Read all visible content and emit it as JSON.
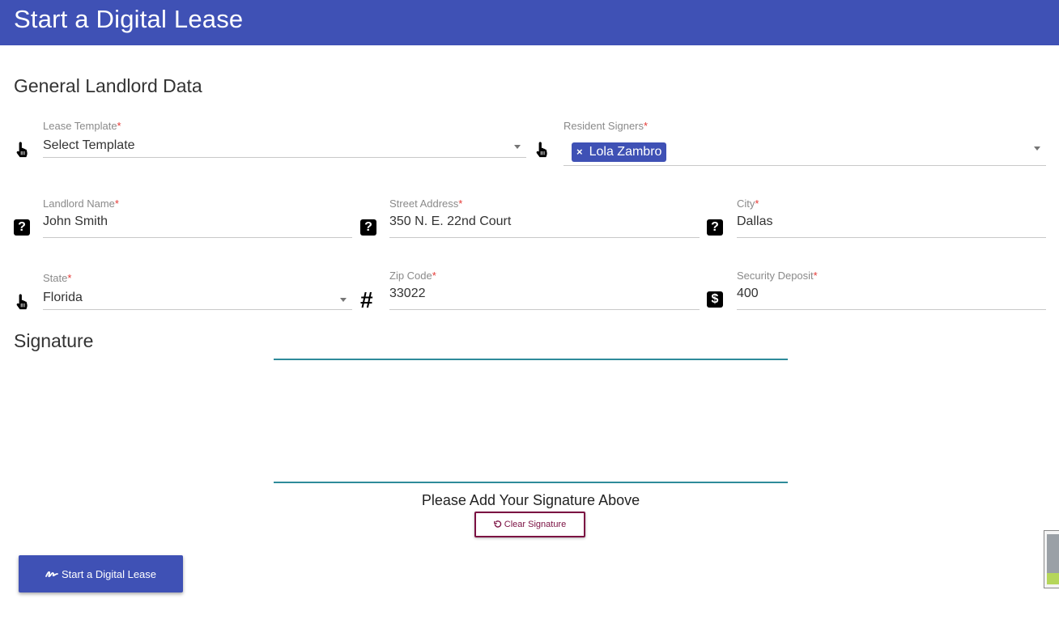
{
  "header": {
    "title": "Start a Digital Lease"
  },
  "sections": {
    "general": "General Landlord Data",
    "signature": "Signature"
  },
  "fields": {
    "lease_template": {
      "label": "Lease Template",
      "required": "*",
      "value": "Select Template",
      "icon": "pointer-hand-icon"
    },
    "resident_signers": {
      "label": "Resident Signers",
      "required": "*",
      "chip": "Lola Zambro",
      "chip_remove": "×",
      "icon": "pointer-hand-icon"
    },
    "landlord_name": {
      "label": "Landlord Name",
      "required": "*",
      "value": "John Smith",
      "icon": "question-icon"
    },
    "street_address": {
      "label": "Street Address",
      "required": "*",
      "value": "350 N. E. 22nd Court",
      "icon": "question-icon"
    },
    "city": {
      "label": "City",
      "required": "*",
      "value": "Dallas",
      "icon": "question-icon"
    },
    "state": {
      "label": "State",
      "required": "*",
      "value": "Florida",
      "icon": "pointer-hand-icon"
    },
    "zip_code": {
      "label": "Zip Code",
      "required": "*",
      "value": "33022",
      "icon": "hash-icon",
      "icon_glyph": "#"
    },
    "security_deposit": {
      "label": "Security Deposit",
      "required": "*",
      "value": "400",
      "icon": "dollar-icon",
      "icon_glyph": "$"
    }
  },
  "question_glyph": "?",
  "signature": {
    "hint": "Please Add Your Signature Above",
    "clear_label": "Clear Signature"
  },
  "submit": {
    "label": "Start a Digital Lease"
  },
  "colors": {
    "primary": "#3f51b5",
    "required": "#e53935",
    "signature_line": "#2e8b9a",
    "clear_button": "#7b1042"
  }
}
